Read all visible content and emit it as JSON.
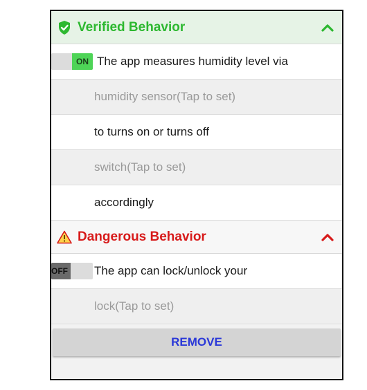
{
  "verified": {
    "title": "Verified Behavior",
    "icon": "shield-check-icon",
    "color": "#2db830",
    "toggle_label": "ON",
    "rows": [
      "The app measures humidity level via",
      "humidity sensor(Tap to set)",
      "to turns on or turns off",
      "switch(Tap to set)",
      "accordingly"
    ]
  },
  "danger": {
    "title": "Dangerous Behavior",
    "icon": "warning-icon",
    "color": "#d71a1a",
    "toggle_label": "OFF",
    "rows": [
      "The app can lock/unlock your",
      "lock(Tap to set)"
    ]
  },
  "actions": {
    "remove_label": "REMOVE"
  }
}
